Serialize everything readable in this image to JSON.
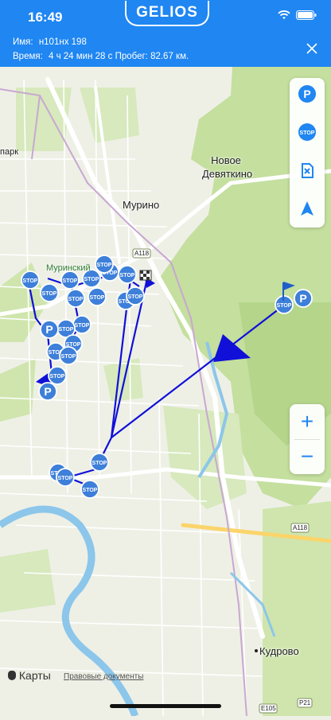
{
  "status_bar": {
    "time": "16:49",
    "brand": "GELIOS"
  },
  "info": {
    "name_label": "Имя:",
    "name_value": "н101нх 198",
    "time_label": "Время:",
    "time_value": "4 ч 24 мин 28 с Пробег: 82.67 км."
  },
  "map": {
    "labels": {
      "novoe_devyatkino": "Новое\nДевяткино",
      "murino": "Мурино",
      "kudrovo": "Кудрово",
      "park": "парк",
      "murinsky": "Муринский",
      "road_a118_top": "А118",
      "road_a118_bottom": "А118",
      "road_e105": "E105",
      "road_p21": "P21"
    },
    "attribution": "Карты",
    "legal_link": "Правовые документы"
  },
  "side_panel": [
    "parking-icon",
    "stop-icon",
    "fuel-icon",
    "locate-icon"
  ],
  "zoom": {
    "in": "+",
    "out": "−"
  },
  "colors": {
    "accent": "#1f86f2",
    "track": "#1010d8",
    "marker": "#3d7fd9"
  }
}
